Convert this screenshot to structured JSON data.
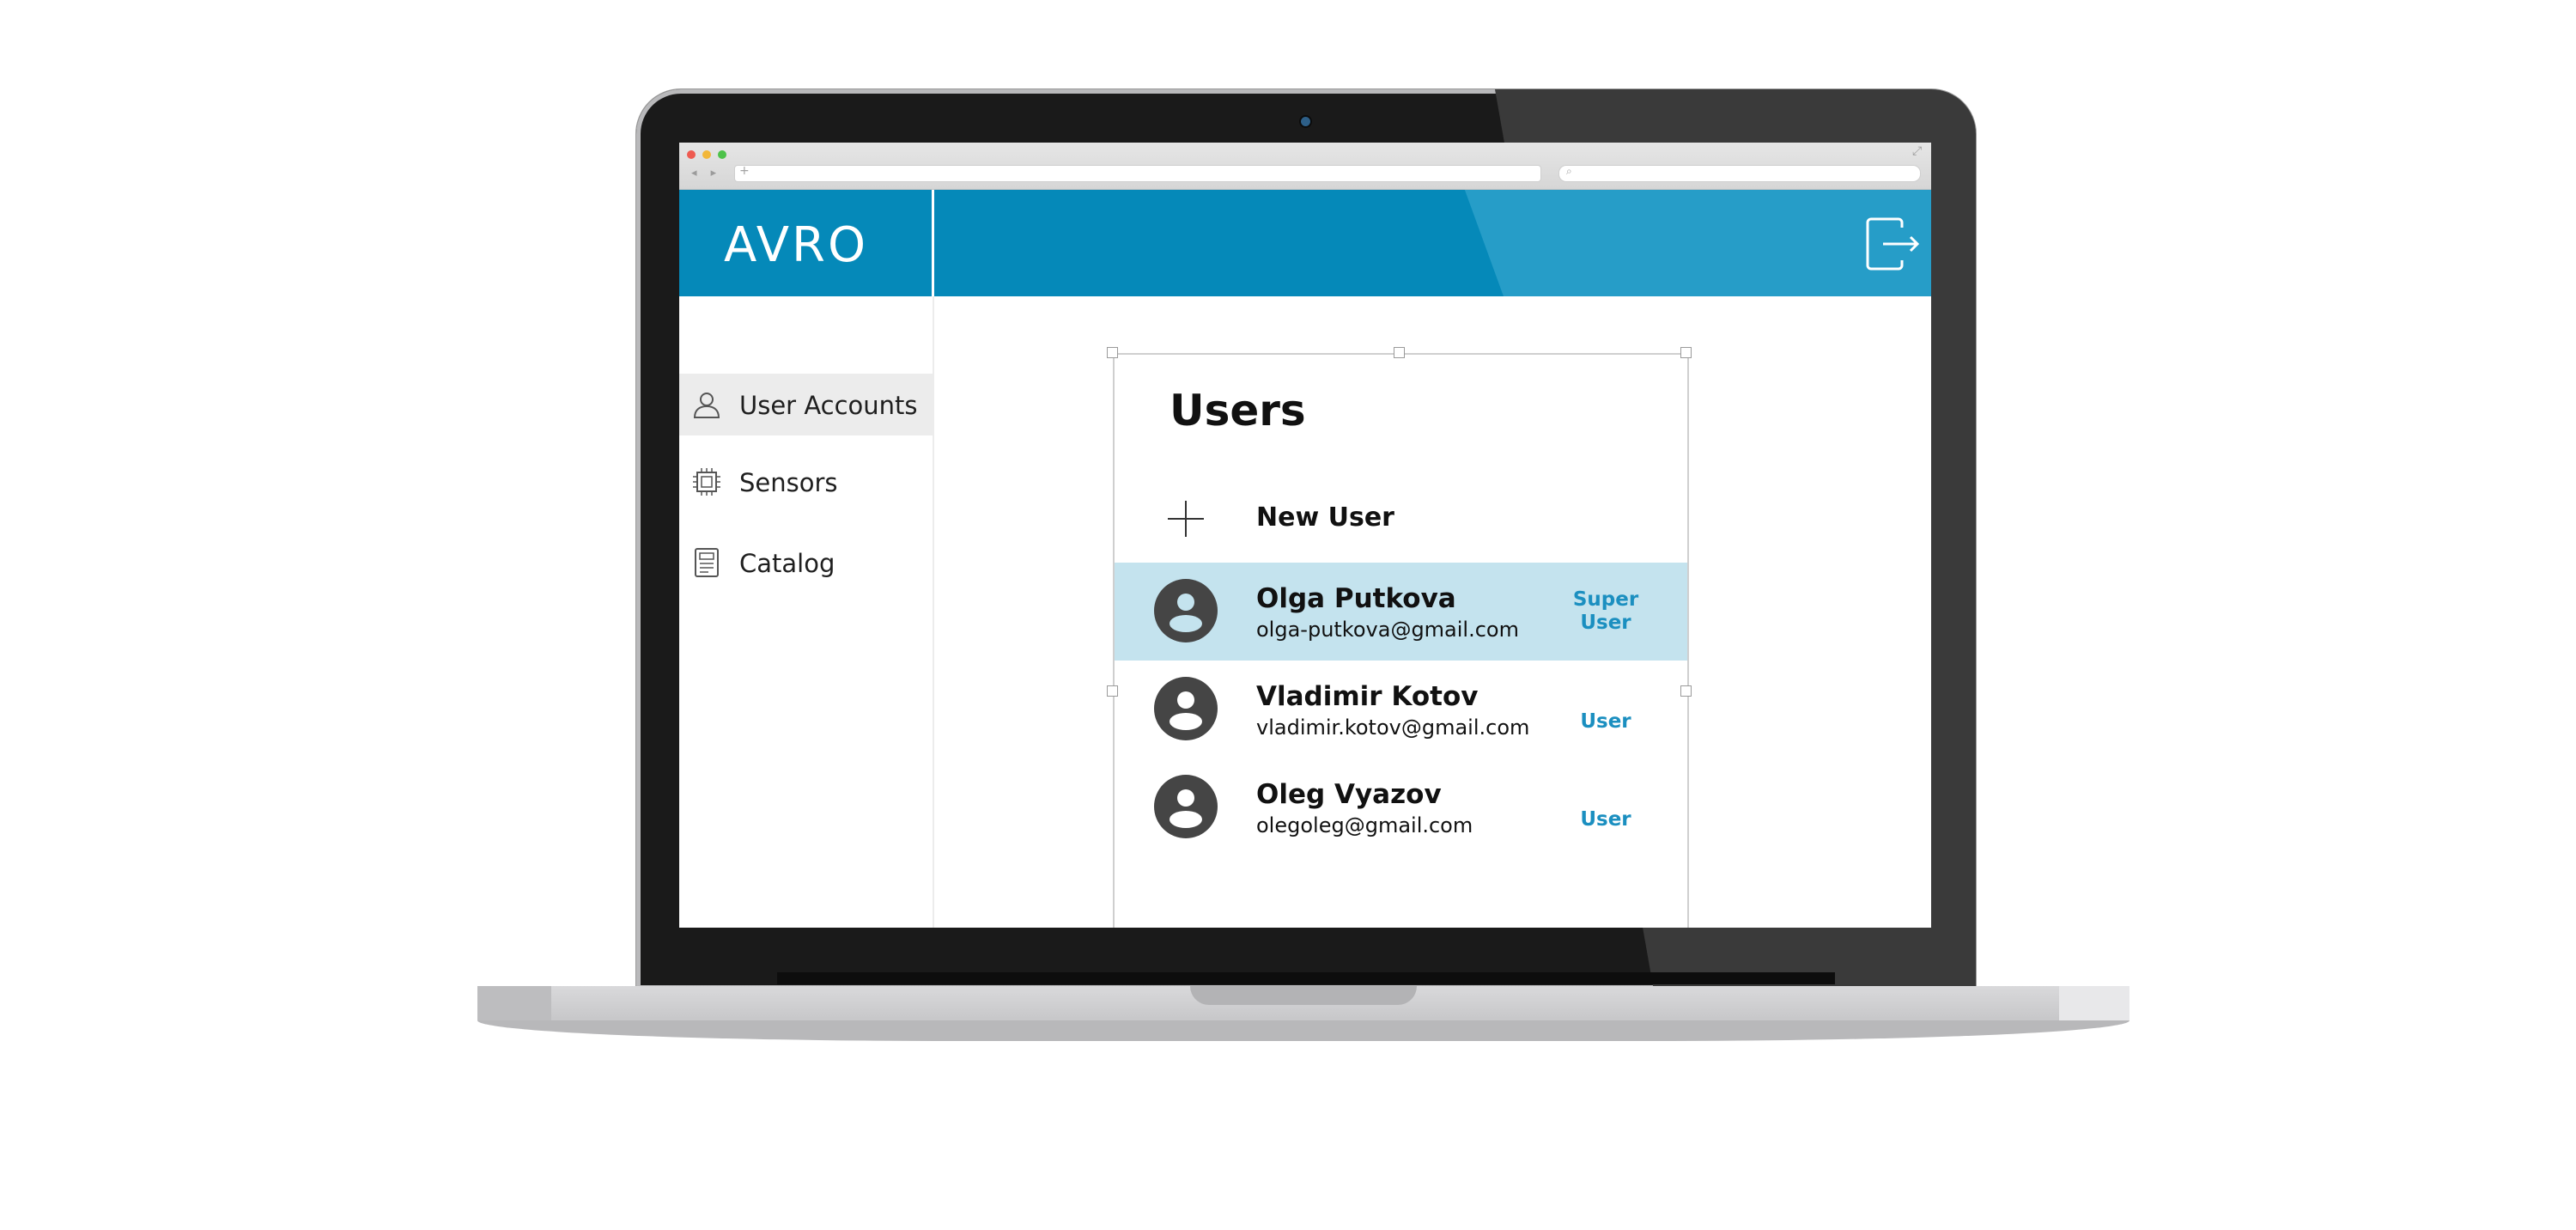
{
  "app": {
    "logo": "AVRO"
  },
  "browser": {
    "nav_arrows": "◂ ▸",
    "url_plus": "+",
    "search_icon": "⌕",
    "fullscreen_icon": "⤢"
  },
  "sidebar": {
    "items": [
      {
        "label": "User Accounts",
        "icon": "user-icon",
        "active": true
      },
      {
        "label": "Sensors",
        "icon": "chip-icon",
        "active": false
      },
      {
        "label": "Catalog",
        "icon": "catalog-icon",
        "active": false
      }
    ]
  },
  "main": {
    "title": "Users",
    "new_user_label": "New User",
    "users": [
      {
        "name": "Olga Putkova",
        "email": "olga-putkova@gmail.com",
        "role_line1": "Super",
        "role_line2": "User",
        "selected": true
      },
      {
        "name": "Vladimir Kotov",
        "email": "vladimir.kotov@gmail.com",
        "role_line1": "User",
        "role_line2": "",
        "selected": false
      },
      {
        "name": "Oleg Vyazov",
        "email": "olegoleg@gmail.com",
        "role_line1": "User",
        "role_line2": "",
        "selected": false
      }
    ]
  },
  "colors": {
    "header": "#0589b9",
    "header_light": "#269dc8",
    "selected_row": "#c4e3ee",
    "role_text": "#1b8fc0",
    "avatar": "#454545"
  }
}
